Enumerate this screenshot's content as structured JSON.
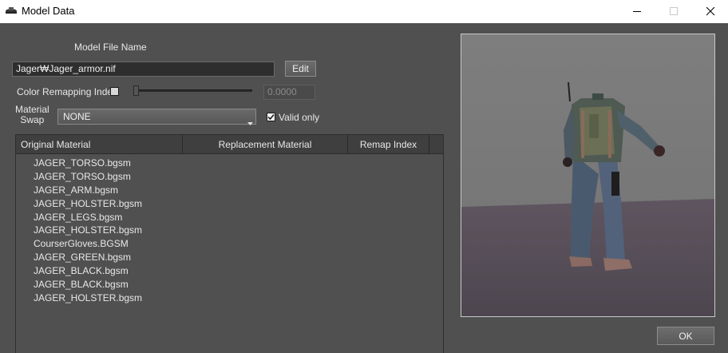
{
  "window": {
    "title": "Model Data"
  },
  "model_file": {
    "label": "Model File Name",
    "value": "Jager₩Jager_armor.nif",
    "edit_label": "Edit"
  },
  "color_remap": {
    "label": "Color Remapping Index",
    "checked": false,
    "value": "0.0000"
  },
  "material_swap": {
    "label_line1": "Material",
    "label_line2": "Swap",
    "selected": "NONE",
    "valid_only_label": "Valid only",
    "valid_only_checked": true
  },
  "table": {
    "columns": [
      "Original Material",
      "Replacement Material",
      "Remap Index"
    ],
    "rows": [
      "JAGER_TORSO.bgsm",
      "JAGER_TORSO.bgsm",
      "JAGER_ARM.bgsm",
      "JAGER_HOLSTER.bgsm",
      "JAGER_LEGS.bgsm",
      "JAGER_HOLSTER.bgsm",
      "CourserGloves.BGSM",
      "JAGER_GREEN.bgsm",
      "JAGER_BLACK.bgsm",
      "JAGER_BLACK.bgsm",
      "JAGER_HOLSTER.bgsm"
    ]
  },
  "footer": {
    "ok_label": "OK"
  },
  "icons": {
    "app": "app-icon",
    "minimize": "minimize-icon",
    "maximize": "maximize-icon",
    "close": "close-icon",
    "checkmark": "checkmark-icon",
    "dropdown": "chevron-down-icon"
  }
}
